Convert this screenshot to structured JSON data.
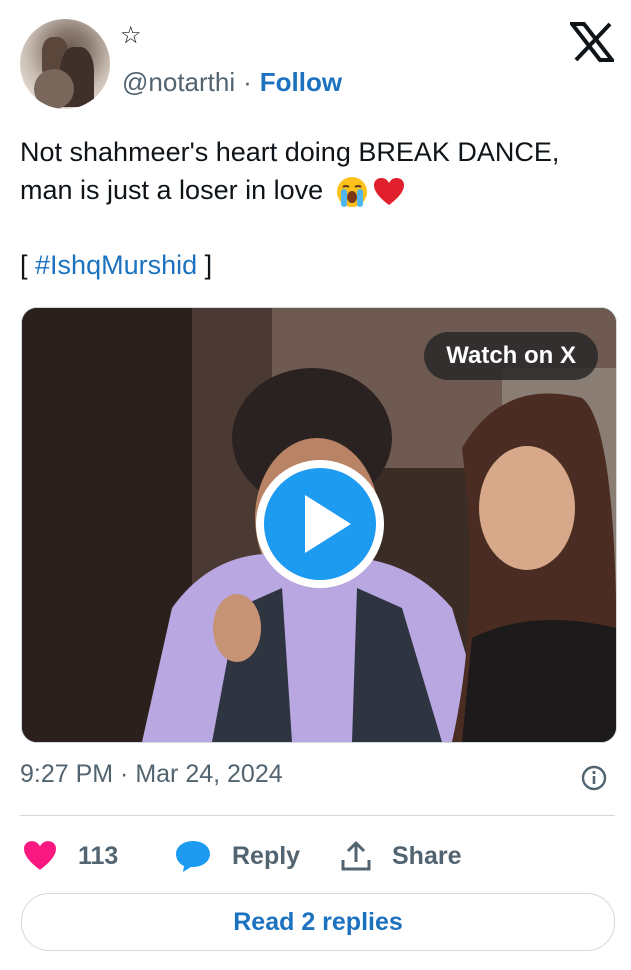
{
  "author": {
    "display_name": "☆",
    "handle": "@notarthi",
    "separator": "·",
    "follow_label": "Follow"
  },
  "tweet": {
    "line1": "Not shahmeer's heart doing BREAK DANCE,",
    "line2": "man is just a loser in love",
    "bracket_open": "[",
    "hashtag": "#IshqMurshid",
    "bracket_close": "]",
    "emojis": [
      "loudly-crying-face-emoji",
      "red-heart-emoji"
    ]
  },
  "media": {
    "watch_label": "Watch on X"
  },
  "meta": {
    "timestamp": "9:27 PM · Mar 24, 2024"
  },
  "actions": {
    "likes": "113",
    "reply_label": "Reply",
    "share_label": "Share"
  },
  "footer": {
    "read_replies_label": "Read 2 replies"
  },
  "colors": {
    "link": "#1d72bf",
    "like": "#f91880",
    "reply_icon": "#1d9bf0",
    "muted": "#536471",
    "play": "#1d9bf0"
  }
}
